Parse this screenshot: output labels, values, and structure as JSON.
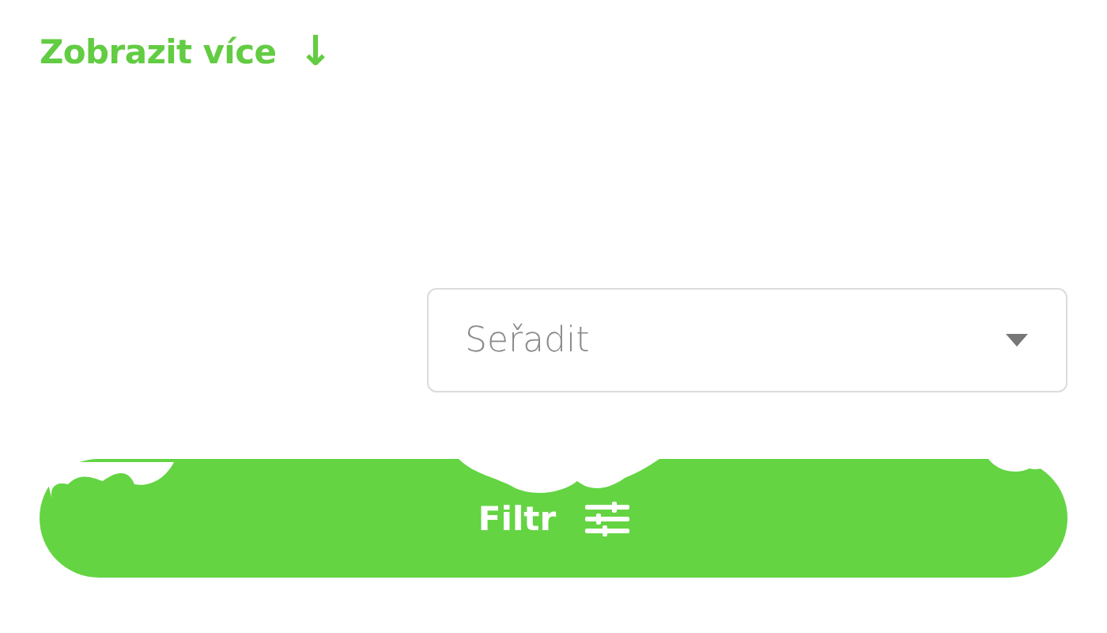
{
  "show_more": {
    "label": "Zobrazit více",
    "icon": "↓"
  },
  "sort": {
    "placeholder": "Seřadit"
  },
  "filter_button": {
    "label": "Filtr"
  }
}
